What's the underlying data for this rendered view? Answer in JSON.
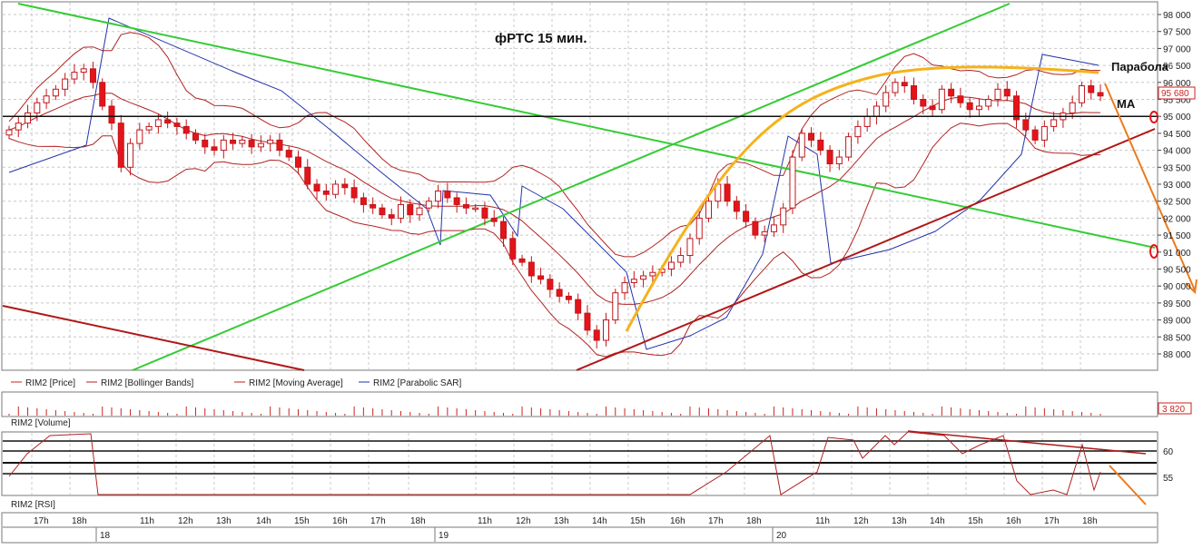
{
  "chart_title": "фРТС   15 мин.",
  "annotations": {
    "parabola": "Парабола",
    "ma": "МА"
  },
  "price_axis": {
    "ticks": [
      "98 000",
      "97 500",
      "97 000",
      "96 500",
      "96 000",
      "95 500",
      "95 000",
      "94 500",
      "94 000",
      "93 500",
      "93 000",
      "92 500",
      "92 000",
      "91 500",
      "91 000",
      "90 500",
      "90 000",
      "89 500",
      "89 000",
      "88 500",
      "88 000"
    ],
    "last_price_label": "95 680"
  },
  "legend": [
    {
      "label": "RIM2 [Price]",
      "color": "#cc2222"
    },
    {
      "label": "RIM2 [Bollinger Bands]",
      "color": "#b22222"
    },
    {
      "label": "RIM2 [Moving Average]",
      "color": "#b22222"
    },
    {
      "label": "RIM2 [Parabolic SAR]",
      "color": "#2233aa"
    }
  ],
  "volume_panel": {
    "title": "RIM2 [Volume]",
    "last_value_label": "3 820"
  },
  "rsi_panel": {
    "title": "RIM2 [RSI]",
    "ticks": [
      "60",
      "55"
    ]
  },
  "time_axis": {
    "hour_labels": [
      "17h",
      "18h",
      "11h",
      "12h",
      "13h",
      "14h",
      "15h",
      "16h",
      "17h",
      "18h",
      "11h",
      "12h",
      "13h",
      "14h",
      "15h",
      "16h",
      "17h",
      "18h",
      "11h",
      "12h",
      "13h",
      "14h",
      "15h",
      "16h",
      "17h",
      "18h"
    ],
    "day_labels": [
      "18",
      "19",
      "20"
    ]
  },
  "colors": {
    "up_candle": "#ffffff",
    "down_candle": "#e3141a",
    "candle_outline": "#c0161b",
    "bollinger": "#b22222",
    "sar": "#2233aa",
    "trend_green": "#33cc33",
    "trend_red": "#b01818",
    "parabola": "#f5b21b",
    "forecast_arrow": "#ec7a1c",
    "grid": "#c8c8c8"
  },
  "chart_data": {
    "type": "candlestick",
    "title": "фРТС   15 мин.",
    "ylim": [
      87700,
      98200
    ],
    "yticks": [
      88000,
      88500,
      89000,
      89500,
      90000,
      90500,
      91000,
      91500,
      92000,
      92500,
      93000,
      93500,
      94000,
      94500,
      95000,
      95500,
      96000,
      96500,
      97000,
      97500,
      98000
    ],
    "horizontal_levels": [
      95000
    ],
    "last_price": 95680,
    "ohlc_close_approx": [
      94600,
      94800,
      95100,
      95400,
      95600,
      95800,
      96100,
      96300,
      96400,
      96000,
      95300,
      94800,
      93500,
      94200,
      94600,
      94700,
      94900,
      94800,
      94700,
      94500,
      94300,
      94100,
      94000,
      94300,
      94200,
      94300,
      94100,
      94200,
      94300,
      94000,
      93800,
      93500,
      93000,
      92800,
      92700,
      93000,
      92900,
      92600,
      92400,
      92300,
      92100,
      92000,
      92400,
      92100,
      92300,
      92500,
      92800,
      92600,
      92400,
      92300,
      92300,
      92000,
      91900,
      91400,
      90800,
      90700,
      90300,
      90200,
      89900,
      89700,
      89600,
      89200,
      88700,
      88400,
      89000,
      89800,
      90100,
      90200,
      90300,
      90400,
      90500,
      90700,
      90900,
      91400,
      92000,
      92500,
      93000,
      92500,
      92200,
      91900,
      91500,
      91600,
      91800,
      92300,
      93800,
      94500,
      94300,
      94000,
      93600,
      93800,
      94400,
      94700,
      95000,
      95300,
      95700,
      96000,
      95900,
      95500,
      95300,
      95200,
      95800,
      95600,
      95400,
      95200,
      95300,
      95500,
      95800,
      95600,
      94900,
      94600,
      94300,
      94700,
      94900,
      95100,
      95400,
      95900,
      95700,
      95600
    ]
  }
}
